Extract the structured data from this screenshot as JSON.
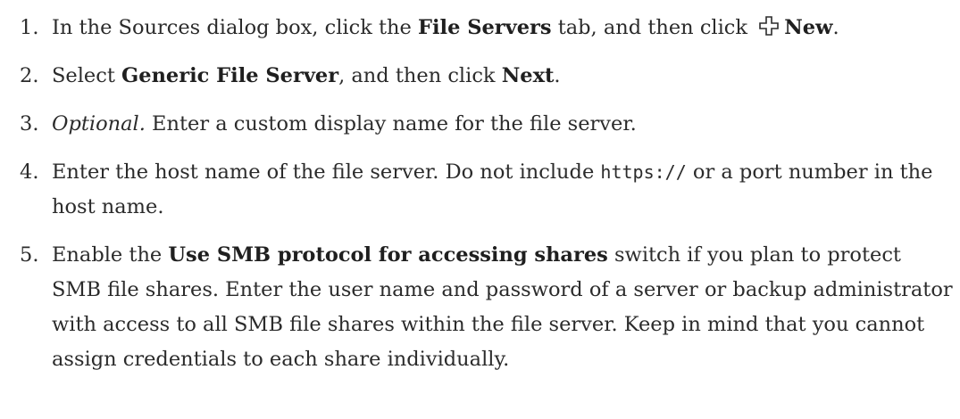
{
  "steps": [
    {
      "num": "1.",
      "t1": "In the Sources dialog box, click the ",
      "b1": "File Servers",
      "t2": " tab, and then click ",
      "icon": "plus-icon",
      "b2": "New",
      "t3": "."
    },
    {
      "num": "2.",
      "t1": "Select ",
      "b1": "Generic File Server",
      "t2": ", and then click ",
      "b2": "Next",
      "t3": "."
    },
    {
      "num": "3.",
      "i1": "Optional.",
      "t1": " Enter a custom display name for the file server."
    },
    {
      "num": "4.",
      "t1": "Enter the host name of the file server. Do not include ",
      "code": "https://",
      "t2": " or a port number in the host name."
    },
    {
      "num": "5.",
      "t1": "Enable the ",
      "b1": "Use SMB protocol for accessing shares",
      "t2": " switch if you plan to protect SMB file shares. Enter the user name and password of a server or backup administrator with access to all SMB file shares within the file server. Keep in mind that you cannot assign credentials to each share individually."
    }
  ]
}
